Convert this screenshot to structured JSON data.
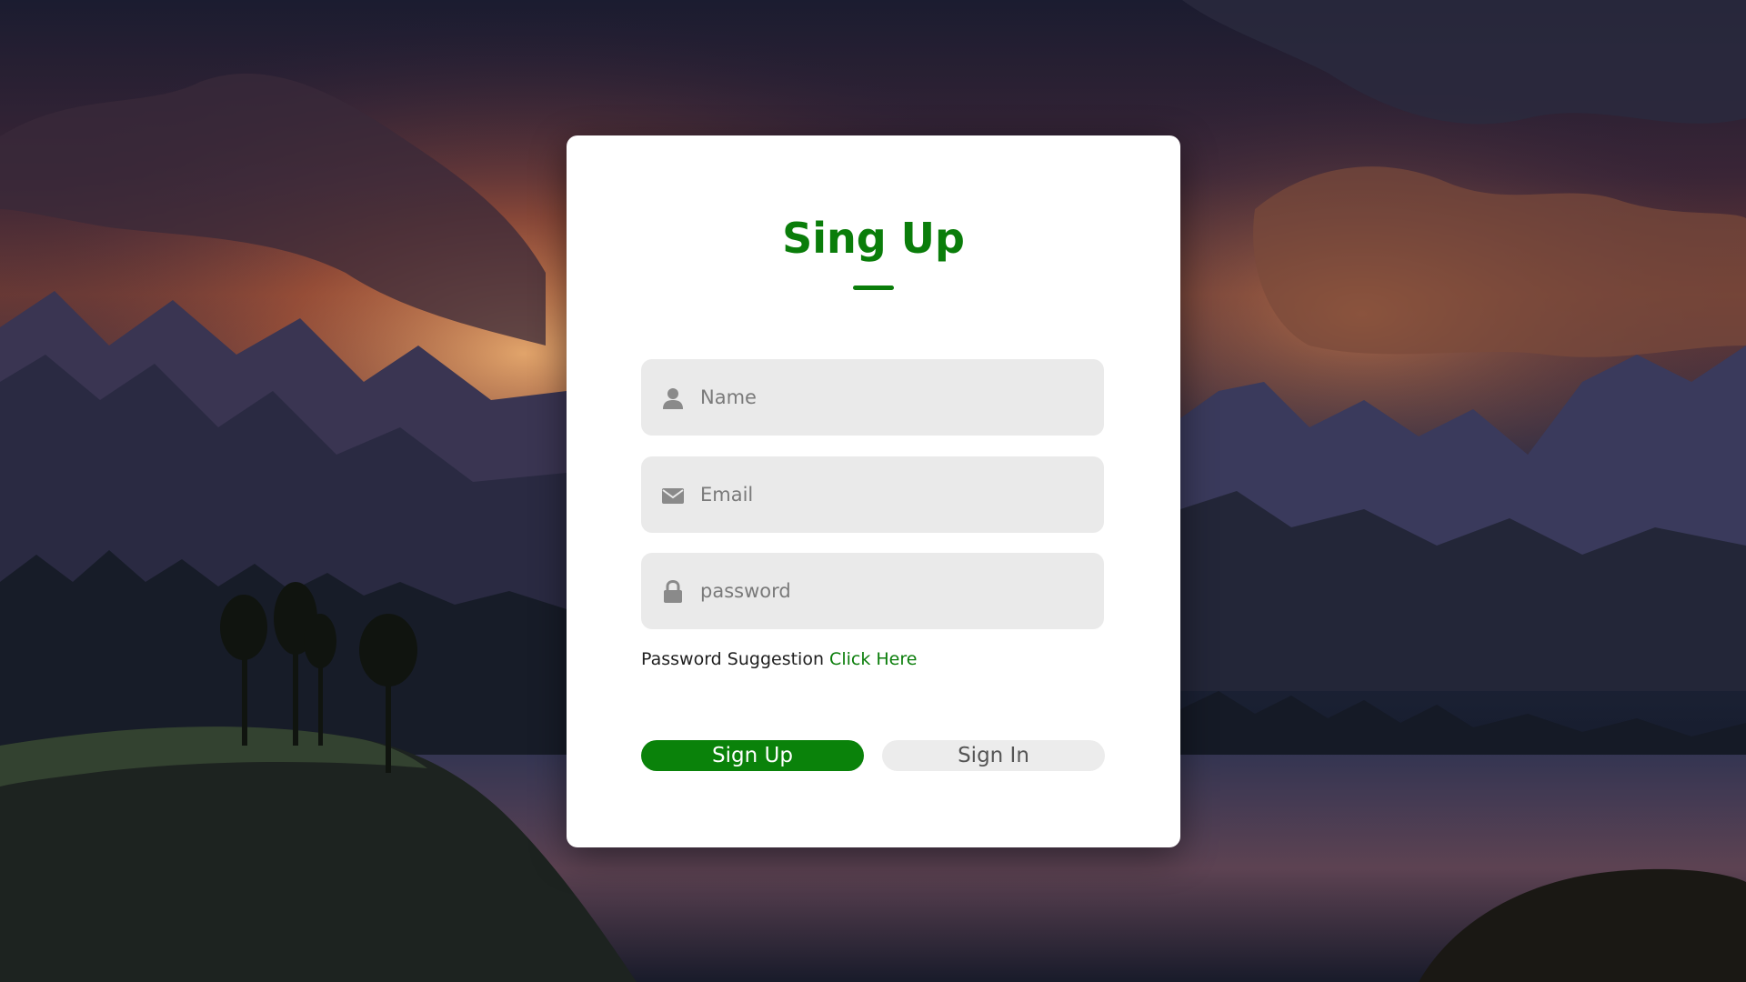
{
  "form": {
    "title": "Sing Up",
    "fields": {
      "name": {
        "placeholder": "Name",
        "icon": "user-icon"
      },
      "email": {
        "placeholder": "Email",
        "icon": "envelope-icon"
      },
      "password": {
        "placeholder": "password",
        "icon": "lock-icon"
      }
    },
    "suggestion": {
      "text": "Password Suggestion",
      "link": "Click Here"
    },
    "buttons": {
      "signup": "Sign Up",
      "signin": "Sign In"
    }
  },
  "colors": {
    "accent": "#0a7d0a",
    "field_bg": "#eaeaea",
    "card_bg": "#ffffff",
    "secondary_button_bg": "#ececec"
  }
}
